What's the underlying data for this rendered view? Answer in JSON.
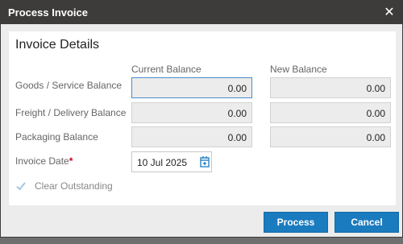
{
  "dialog": {
    "title": "Process Invoice",
    "close_icon": "close-icon"
  },
  "panel": {
    "title": "Invoice Details",
    "columns": {
      "current": "Current Balance",
      "new": "New Balance"
    },
    "rows": [
      {
        "label": "Goods / Service Balance",
        "current": "0.00",
        "new": "0.00"
      },
      {
        "label": "Freight / Delivery Balance",
        "current": "0.00",
        "new": "0.00"
      },
      {
        "label": "Packaging Balance",
        "current": "0.00",
        "new": "0.00"
      }
    ],
    "invoice_date": {
      "label": "Invoice Date",
      "required_mark": "*",
      "value": "10 Jul 2025",
      "icon": "calendar-icon"
    },
    "clear_outstanding": {
      "label": "Clear Outstanding",
      "checked": true
    }
  },
  "buttons": {
    "process": "Process",
    "cancel": "Cancel"
  },
  "colors": {
    "titlebar": "#3d3c3b",
    "primary_button": "#1a7bbf",
    "required": "#d0021b"
  }
}
